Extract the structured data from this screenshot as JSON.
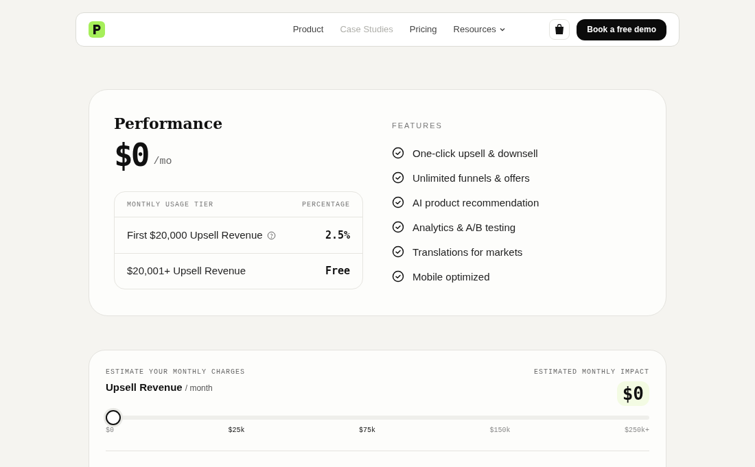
{
  "nav": {
    "links": [
      {
        "label": "Product",
        "muted": false,
        "dropdown": false
      },
      {
        "label": "Case Studies",
        "muted": true,
        "dropdown": false
      },
      {
        "label": "Pricing",
        "muted": false,
        "dropdown": false
      },
      {
        "label": "Resources",
        "muted": false,
        "dropdown": true
      }
    ],
    "cta": "Book a free demo"
  },
  "plan": {
    "name": "Performance",
    "price": "$0",
    "period": "/mo",
    "table": {
      "columns": [
        "MONTHLY USAGE TIER",
        "PERCENTAGE"
      ],
      "rows": [
        {
          "tier": "First $20,000 Upsell Revenue",
          "info": true,
          "rate": "2.5%"
        },
        {
          "tier": "$20,001+ Upsell Revenue",
          "info": false,
          "rate": "Free"
        }
      ]
    },
    "features_label": "FEATURES",
    "features": [
      "One-click upsell & downsell",
      "Unlimited funnels & offers",
      "AI product recommendation",
      "Analytics & A/B testing",
      "Translations for markets",
      "Mobile optimized"
    ]
  },
  "estimator": {
    "eyebrow": "ESTIMATE YOUR MONTHLY CHARGES",
    "title": "Upsell Revenue",
    "unit": "/ month",
    "impact_label": "ESTIMATED MONTHLY IMPACT",
    "impact": "$0",
    "slider": {
      "level": 0
    },
    "ticks": [
      {
        "label": "$0",
        "highlighted": false
      },
      {
        "label": "$25k",
        "highlighted": true
      },
      {
        "label": "$75k",
        "highlighted": true
      },
      {
        "label": "$150k",
        "highlighted": false
      },
      {
        "label": "$250k+",
        "highlighted": false
      }
    ]
  }
}
